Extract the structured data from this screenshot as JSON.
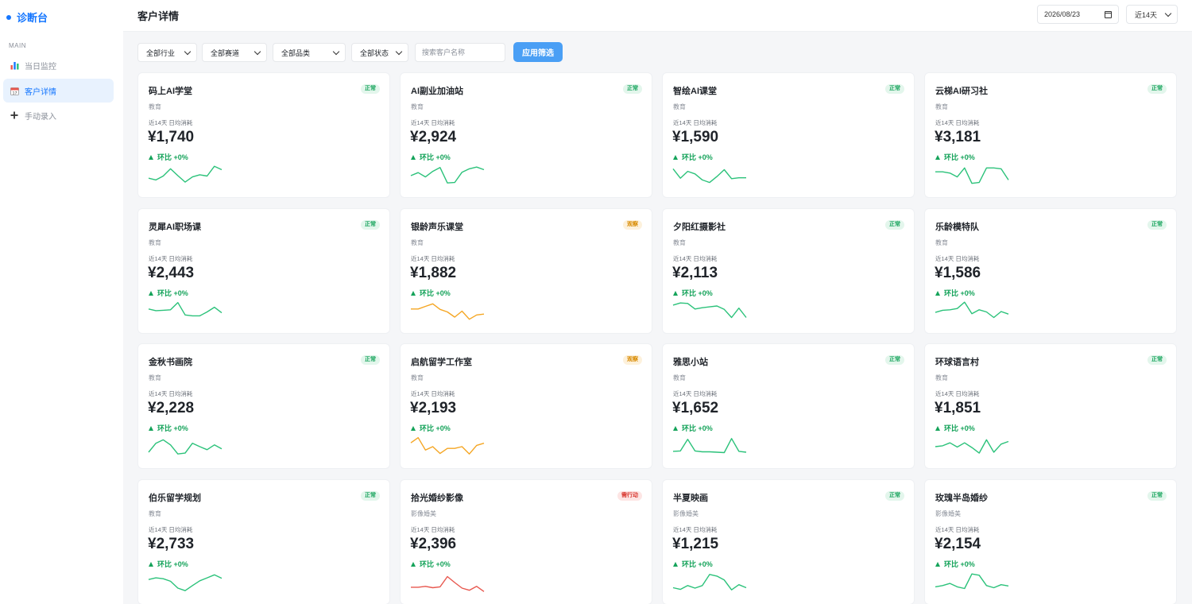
{
  "brand": {
    "name": "诊断台",
    "color": "#1677ff"
  },
  "sidebar": {
    "section": "MAIN",
    "items": [
      {
        "label": "当日监控",
        "icon": "bar-chart-icon",
        "active": false
      },
      {
        "label": "客户详情",
        "icon": "calendar-icon",
        "active": true
      },
      {
        "label": "手动录入",
        "icon": "plus-icon",
        "active": false
      }
    ]
  },
  "header": {
    "title": "客户详情",
    "date": "2026/08/23",
    "range": "近14天"
  },
  "filters": {
    "industry": "全部行业",
    "track": "全部赛道",
    "category": "全部品类",
    "status": "全部状态",
    "search_placeholder": "搜索客户名称",
    "apply": "应用筛选"
  },
  "colors": {
    "ok": "#2bc27a",
    "watch": "#f5a623",
    "act": "#e8574e"
  },
  "customers": [
    {
      "name": "码上AI学堂",
      "badge": "正常",
      "status": "ok",
      "category": "教育",
      "metric": "近14天 日均消耗",
      "value": "¥1,740",
      "change": "环比 +0%",
      "trend": [
        4,
        3.6,
        4.5,
        6.2,
        4.6,
        3.1,
        4.3,
        4.8,
        4.5,
        6.8,
        6
      ]
    },
    {
      "name": "AI副业加油站",
      "badge": "正常",
      "status": "ok",
      "category": "教育",
      "metric": "近14天 日均消耗",
      "value": "¥2,924",
      "change": "环比 +0%",
      "trend": [
        4.6,
        5.3,
        4.3,
        5.6,
        6.5,
        2.9,
        3,
        5.4,
        6.2,
        6.6,
        6
      ]
    },
    {
      "name": "智绘AI课堂",
      "badge": "正常",
      "status": "ok",
      "category": "教育",
      "metric": "近14天 日均消耗",
      "value": "¥1,590",
      "change": "环比 +0%",
      "trend": [
        6.2,
        4,
        5.6,
        5,
        3.6,
        3,
        4.4,
        6,
        3.9,
        4.1,
        4.1
      ]
    },
    {
      "name": "云梯AI研习社",
      "badge": "正常",
      "status": "ok",
      "category": "教育",
      "metric": "近14天 日均消耗",
      "value": "¥3,181",
      "change": "环比 +0%",
      "trend": [
        5.5,
        5.5,
        5.2,
        4.3,
        6.4,
        2.8,
        3,
        6.4,
        6.4,
        6.2,
        3.6
      ]
    },
    {
      "name": "灵犀AI职场课",
      "badge": "正常",
      "status": "ok",
      "category": "教育",
      "metric": "近14天 日均消耗",
      "value": "¥2,443",
      "change": "环比 +0%",
      "trend": [
        5.2,
        4.8,
        4.9,
        5,
        6.7,
        3.8,
        3.6,
        3.6,
        4.5,
        5.6,
        4.3
      ]
    },
    {
      "name": "银龄声乐课堂",
      "badge": "观察",
      "status": "watch",
      "category": "教育",
      "metric": "近14天 日均消耗",
      "value": "¥1,882",
      "change": "环比 +0%",
      "trend": [
        5.2,
        5.2,
        5.8,
        6.4,
        5.1,
        4.5,
        3.3,
        4.7,
        2.8,
        3.8,
        4
      ]
    },
    {
      "name": "夕阳红摄影社",
      "badge": "正常",
      "status": "ok",
      "category": "教育",
      "metric": "近14天 日均消耗",
      "value": "¥2,113",
      "change": "环比 +0%",
      "trend": [
        6.1,
        6.6,
        6.5,
        5.2,
        5.5,
        5.7,
        5.9,
        5.1,
        3.2,
        5.4,
        3.2
      ]
    },
    {
      "name": "乐龄模特队",
      "badge": "正常",
      "status": "ok",
      "category": "教育",
      "metric": "近14天 日均消耗",
      "value": "¥1,586",
      "change": "环比 +0%",
      "trend": [
        4.4,
        4.9,
        5,
        5.3,
        6.8,
        4.1,
        5,
        4.5,
        3.2,
        4.6,
        4
      ]
    },
    {
      "name": "金秋书画院",
      "badge": "正常",
      "status": "ok",
      "category": "教育",
      "metric": "近14天 日均消耗",
      "value": "¥2,228",
      "change": "环比 +0%",
      "trend": [
        3.3,
        5.4,
        6.2,
        5,
        2.9,
        3.1,
        5.4,
        4.6,
        3.9,
        5,
        4.1
      ]
    },
    {
      "name": "启航留学工作室",
      "badge": "观察",
      "status": "watch",
      "category": "教育",
      "metric": "近14天 日均消耗",
      "value": "¥2,193",
      "change": "环比 +0%",
      "trend": [
        5.5,
        6.7,
        3.8,
        4.6,
        3,
        4.2,
        4.2,
        4.6,
        2.9,
        4.9,
        5.4
      ]
    },
    {
      "name": "雅思小站",
      "badge": "正常",
      "status": "ok",
      "category": "教育",
      "metric": "近14天 日均消耗",
      "value": "¥1,652",
      "change": "环比 +0%",
      "trend": [
        3.5,
        3.6,
        6.3,
        3.6,
        3.4,
        3.4,
        3.3,
        3.2,
        6.5,
        3.5,
        3.3
      ]
    },
    {
      "name": "环球语言村",
      "badge": "正常",
      "status": "ok",
      "category": "教育",
      "metric": "近14天 日均消耗",
      "value": "¥1,851",
      "change": "环比 +0%",
      "trend": [
        4.6,
        4.8,
        5.5,
        4.5,
        5.5,
        4.4,
        3.1,
        6.2,
        3.3,
        5.2,
        5.8
      ]
    },
    {
      "name": "伯乐留学规划",
      "badge": "正常",
      "status": "ok",
      "category": "教育",
      "metric": "近14天 日均消耗",
      "value": "¥2,733",
      "change": "环比 +0%",
      "trend": [
        5.3,
        5.7,
        5.5,
        4.9,
        3.3,
        2.7,
        3.9,
        5,
        5.7,
        6.4,
        5.6
      ]
    },
    {
      "name": "拾光婚纱影像",
      "badge": "需行动",
      "status": "act",
      "category": "影像婚美",
      "metric": "近14天 日均消耗",
      "value": "¥2,396",
      "change": "环比 +0%",
      "trend": [
        3.5,
        3.5,
        3.7,
        3.4,
        3.6,
        6,
        4.6,
        3.3,
        2.8,
        3.7,
        2.5
      ]
    },
    {
      "name": "半夏映画",
      "badge": "正常",
      "status": "ok",
      "category": "影像婚美",
      "metric": "近14天 日均消耗",
      "value": "¥1,215",
      "change": "环比 +0%",
      "trend": [
        3.4,
        3,
        3.9,
        3.3,
        3.9,
        6.5,
        6.1,
        5.2,
        2.9,
        4.1,
        3.4
      ]
    },
    {
      "name": "玫瑰半岛婚纱",
      "badge": "正常",
      "status": "ok",
      "category": "影像婚美",
      "metric": "近14天 日均消耗",
      "value": "¥2,154",
      "change": "环比 +0%",
      "trend": [
        3.6,
        3.9,
        4.4,
        3.6,
        3.2,
        6.6,
        6.3,
        3.9,
        3.4,
        4.1,
        3.8
      ]
    }
  ]
}
